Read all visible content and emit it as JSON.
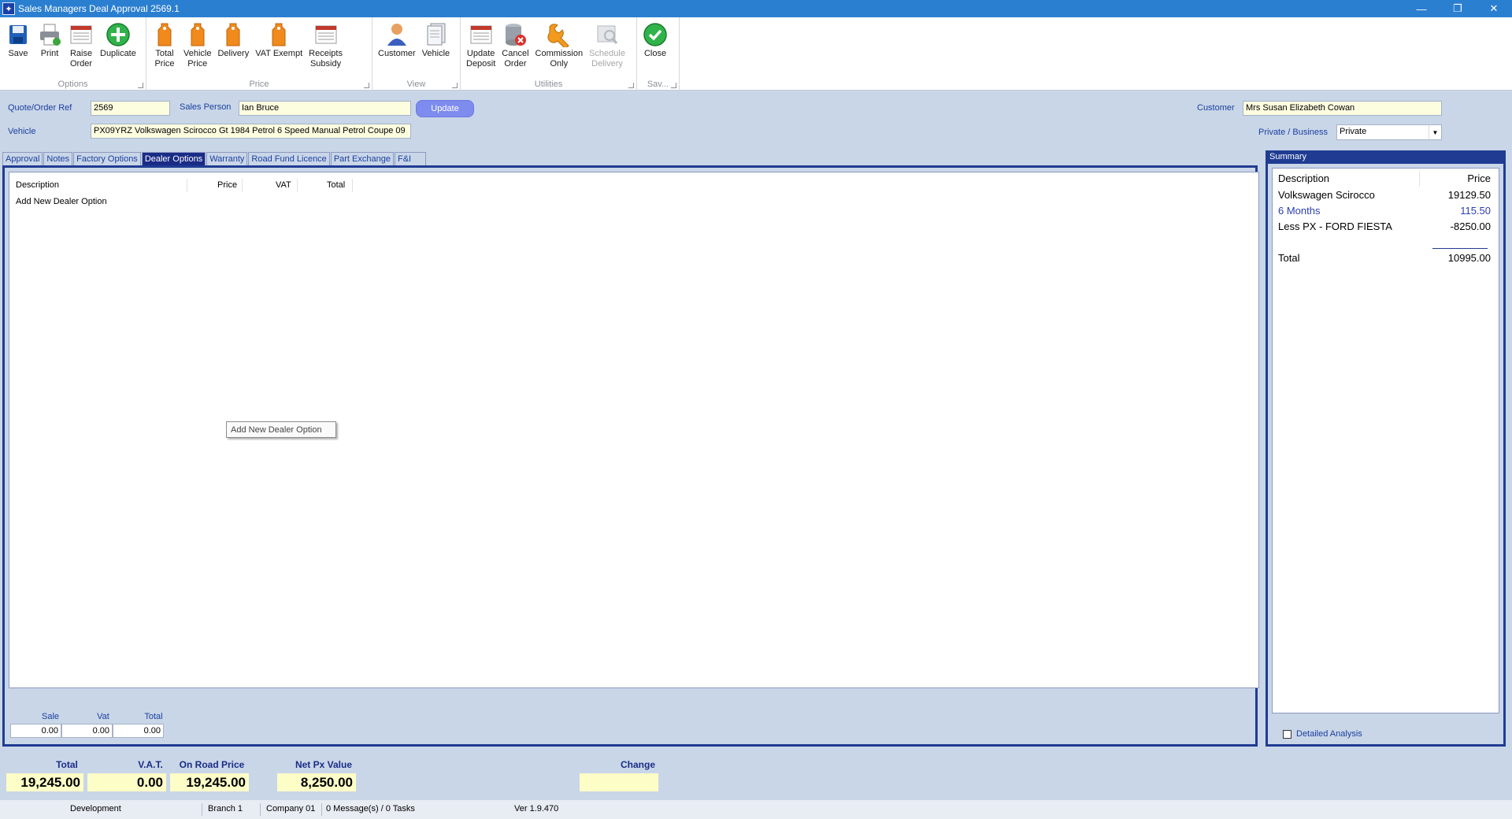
{
  "window": {
    "title": "Sales Managers Deal Approval 2569.1",
    "minimize": "—",
    "restore": "❐",
    "close": "✕"
  },
  "ribbon": {
    "groups": {
      "options": "Options",
      "price": "Price",
      "view": "View",
      "utilities": "Utilities",
      "save": "Sav..."
    },
    "buttons": {
      "save": "Save",
      "print": "Print",
      "raise_order": "Raise\nOrder",
      "duplicate": "Duplicate",
      "total_price": "Total\nPrice",
      "vehicle_price": "Vehicle\nPrice",
      "delivery": "Delivery",
      "vat_exempt": "VAT Exempt",
      "receipts_subsidy": "Receipts\nSubsidy",
      "customer": "Customer",
      "vehicle": "Vehicle",
      "update_deposit": "Update\nDeposit",
      "cancel_order": "Cancel\nOrder",
      "commission_only": "Commission\nOnly",
      "schedule_delivery": "Schedule\nDelivery",
      "close": "Close"
    }
  },
  "header": {
    "quote_label": "Quote/Order Ref",
    "quote_value": "2569",
    "sales_person_label": "Sales Person",
    "sales_person_value": "Ian Bruce",
    "update_button": "Update",
    "vehicle_label": "Vehicle",
    "vehicle_value": "PX09YRZ Volkswagen Scirocco Gt 1984 Petrol 6 Speed Manual Petrol Coupe 09",
    "customer_label": "Customer",
    "customer_value": "Mrs Susan Elizabeth Cowan",
    "private_business_label": "Private / Business",
    "private_business_value": "Private"
  },
  "tabs": [
    "Approval",
    "Notes",
    "Factory Options",
    "Dealer Options",
    "Warranty",
    "Road Fund Licence",
    "Part Exchange",
    "F&I"
  ],
  "dealer_options": {
    "columns": {
      "description": "Description",
      "price": "Price",
      "vat": "VAT",
      "total": "Total"
    },
    "add_row": "Add New Dealer Option",
    "context_button": "Add New Dealer Option",
    "totals": {
      "sale_label": "Sale",
      "vat_label": "Vat",
      "total_label": "Total",
      "sale": "0.00",
      "vat": "0.00",
      "total": "0.00"
    }
  },
  "summary": {
    "title": "Summary",
    "col_description": "Description",
    "col_price": "Price",
    "rows": [
      {
        "description": "Volkswagen Scirocco",
        "price": "19129.50"
      },
      {
        "description": "6 Months",
        "price": "115.50"
      },
      {
        "description": "Less PX - FORD FIESTA",
        "price": "-8250.00"
      }
    ],
    "total_label": "Total",
    "total_value": "10995.00",
    "detailed_analysis": "Detailed Analysis"
  },
  "bottom": {
    "total_label": "Total",
    "total_value": "19,245.00",
    "vat_label": "V.A.T.",
    "vat_value": "0.00",
    "on_road_label": "On Road Price",
    "on_road_value": "19,245.00",
    "net_px_label": "Net Px Value",
    "net_px_value": "8,250.00",
    "change_label": "Change",
    "change_value": ""
  },
  "status": {
    "environment": "Development",
    "branch": "Branch 1",
    "company": "Company 01",
    "messages": "0 Message(s) / 0 Tasks",
    "version": "Ver 1.9.470"
  },
  "colors": {
    "titlebar": "#2b7fd1",
    "frame": "#1f3c92",
    "panel": "#c9d6e8",
    "input_yellow": "#fdfde0",
    "active_tab": "#1a2c86",
    "update_button": "#7e8cf0"
  }
}
